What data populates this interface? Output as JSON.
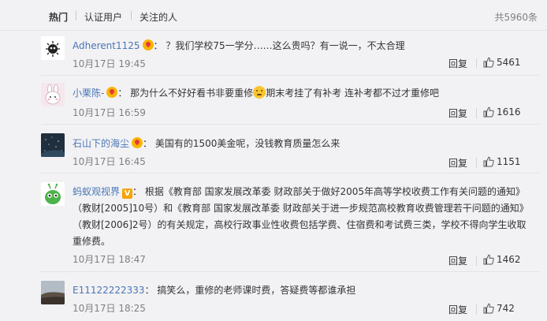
{
  "tabs": {
    "hot": "热门",
    "verified": "认证用户",
    "following": "关注的人",
    "total": "共5960条"
  },
  "comments": [
    {
      "user": "Adherent1125",
      "text": "？我们学校75一学分……这么贵吗？有一说一，不太合理",
      "time": "10月17日 19:45",
      "reply": "回复",
      "likes": "5461"
    },
    {
      "user": "小栗陈-",
      "text_before": "那为什么不好好看书非要重修",
      "text_after": "期末考挂了有补考 连补考都不过才重修吧",
      "time": "10月17日 16:59",
      "reply": "回复",
      "likes": "1616"
    },
    {
      "user": "石山下的海尘",
      "text": "美国有的1500美金呢，没钱教育质量怎么来",
      "time": "10月17日 16:45",
      "reply": "回复",
      "likes": "1151"
    },
    {
      "user": "蚂蚁观视界",
      "line1": "根据《教育部 国家发展改革委 财政部关于做好2005年高等学校收费工作有关问题的通知》",
      "line2": "（教财[2005]10号）和《教育部 国家发展改革委 财政部关于进一步规范高校教育收费管理若干问题的通知》",
      "line3": "（教财[2006]2号）的有关规定，高校行政事业性收费包括学费、住宿费和考试费三类，学校不得向学生收取",
      "line4": "重修费。",
      "time": "10月17日 18:47",
      "reply": "回复",
      "likes": "1462"
    },
    {
      "user": "E11122222333",
      "text": "搞笑么，重修的老师课时费，答疑费等都谁承担",
      "time": "10月17日 18:25",
      "reply": "回复",
      "likes": "742"
    }
  ],
  "colors": {
    "username": "#4a76b4",
    "text": "#333333",
    "meta": "#808080",
    "background": "#f2f2f5"
  }
}
